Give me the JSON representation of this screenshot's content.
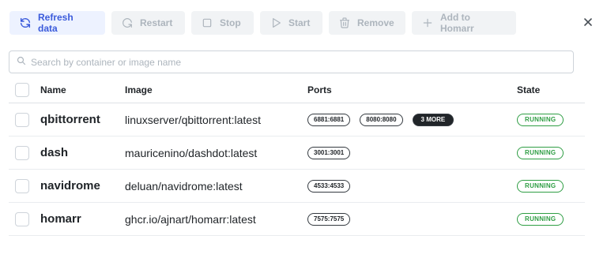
{
  "toolbar": {
    "refresh": {
      "label": "Refresh data",
      "icon": "refresh-icon"
    },
    "restart": {
      "label": "Restart",
      "icon": "rotate-icon"
    },
    "stop": {
      "label": "Stop",
      "icon": "stop-square-icon"
    },
    "start": {
      "label": "Start",
      "icon": "play-icon"
    },
    "remove": {
      "label": "Remove",
      "icon": "trash-icon"
    },
    "add": {
      "label": "Add to Homarr",
      "icon": "plus-icon"
    }
  },
  "close_icon": "close-icon",
  "search": {
    "placeholder": "Search by container or image name",
    "value": ""
  },
  "table": {
    "headers": {
      "name": "Name",
      "image": "Image",
      "ports": "Ports",
      "state": "State"
    },
    "rows": [
      {
        "name": "qbittorrent",
        "image": "linuxserver/qbittorrent:latest",
        "ports": [
          "6881:6881",
          "8080:8080"
        ],
        "more": "3 MORE",
        "state": "RUNNING"
      },
      {
        "name": "dash",
        "image": "mauricenino/dashdot:latest",
        "ports": [
          "3001:3001"
        ],
        "more": null,
        "state": "RUNNING"
      },
      {
        "name": "navidrome",
        "image": "deluan/navidrome:latest",
        "ports": [
          "4533:4533"
        ],
        "more": null,
        "state": "RUNNING"
      },
      {
        "name": "homarr",
        "image": "ghcr.io/ajnart/homarr:latest",
        "ports": [
          "7575:7575"
        ],
        "more": null,
        "state": "RUNNING"
      }
    ]
  },
  "colors": {
    "primary": "#3b5bdb",
    "primary_bg": "#edf2ff",
    "disabled": "#adb5bd",
    "running": "#2f9e44"
  }
}
